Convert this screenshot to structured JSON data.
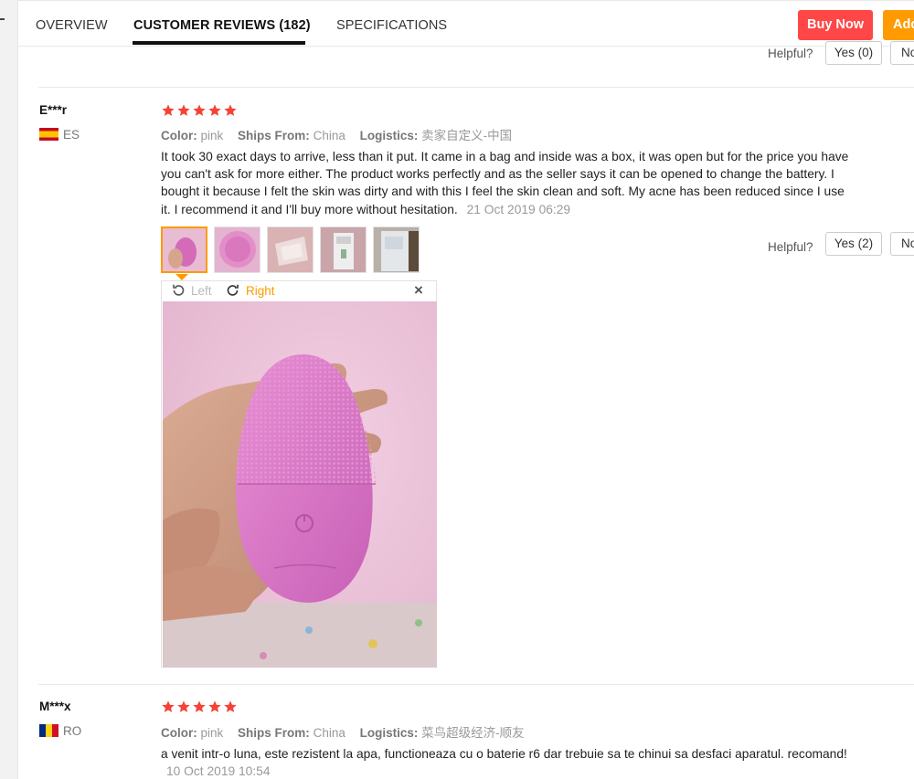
{
  "tabs": {
    "overview": "OVERVIEW",
    "reviews": "CUSTOMER REVIEWS (182)",
    "specifications": "SPECIFICATIONS"
  },
  "actions": {
    "buy_now": "Buy Now",
    "add": "Add"
  },
  "top_review_footer": {
    "helpful_label": "Helpful?",
    "yes": "Yes (0)",
    "no": "No"
  },
  "reviews": [
    {
      "name": "E***r",
      "country": "ES",
      "rating": 5,
      "color_label": "Color:",
      "color": "pink",
      "ships_label": "Ships From:",
      "ships": "China",
      "logistics_label": "Logistics:",
      "logistics": "卖家自定义-中国",
      "text": "It took 30 exact days to arrive, less than it put. It came in a bag and inside was a box, it was open but for the price you have you can't ask for more either. The product works perfectly and as the seller says it can be opened to change the battery. I bought it because I felt the skin was dirty and with this I feel the skin clean and soft. My acne has been reduced since I use it. I recommend it and I'll buy more without hesitation.",
      "date": "21 Oct 2019 06:29",
      "helpful_label": "Helpful?",
      "yes": "Yes (2)",
      "no": "No",
      "viewer": {
        "rotate_left": "Left",
        "rotate_right": "Right",
        "close": "×"
      }
    },
    {
      "name": "M***x",
      "country": "RO",
      "rating": 5,
      "color_label": "Color:",
      "color": "pink",
      "ships_label": "Ships From:",
      "ships": "China",
      "logistics_label": "Logistics:",
      "logistics": "菜鸟超级经济-顺友",
      "text": "a venit intr-o luna, este rezistent la apa, functioneaza cu o baterie r6 dar trebuie sa te chinui sa desfaci aparatul. recomand!",
      "date": "10 Oct 2019 10:54"
    }
  ],
  "colors": {
    "buy_now": "#ff4747",
    "add": "#ff9a00",
    "star": "#f44336",
    "active_thumb": "#ff9a00"
  }
}
